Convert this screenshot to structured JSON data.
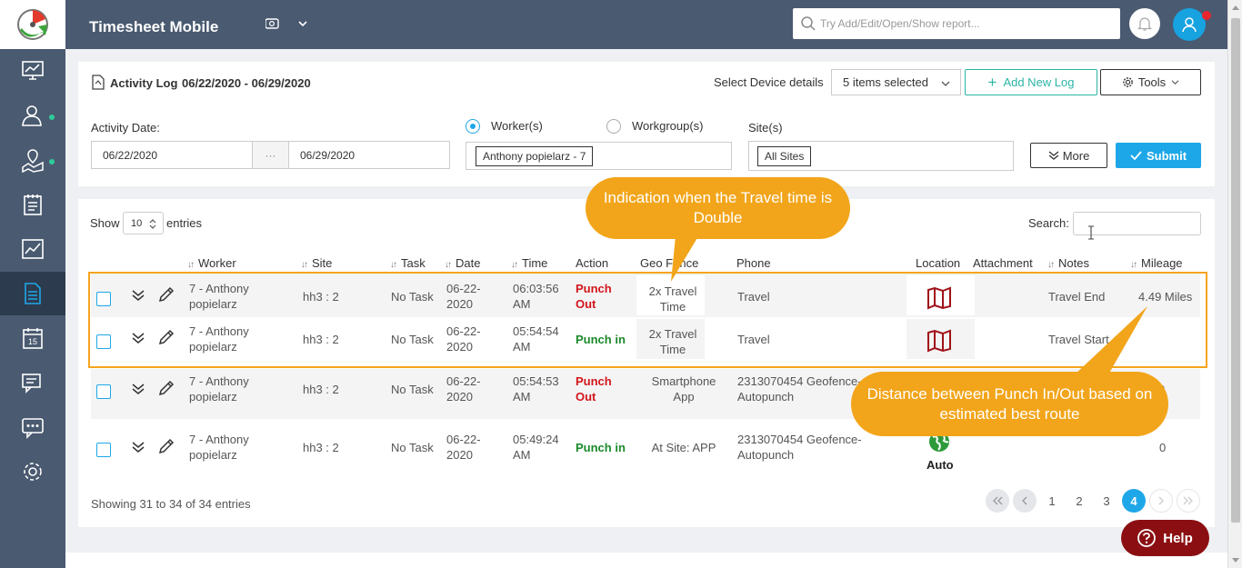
{
  "header": {
    "app_title": "Timesheet Mobile",
    "search_placeholder": "Try Add/Edit/Open/Show report..."
  },
  "sidebar": {
    "items": [
      "dashboard-icon",
      "workers-icon",
      "geo-location-icon",
      "timesheet-icon",
      "reports-chart-icon",
      "activity-log-icon",
      "calendar-icon",
      "messages-icon",
      "chat-icon",
      "settings-icon"
    ],
    "calendar_day": "15",
    "active": "activity-log-icon"
  },
  "filters": {
    "title": "Activity Log",
    "range": "06/22/2020 - 06/29/2020",
    "select_device_label": "Select Device details",
    "device_selected": "5 items selected",
    "add_log": "Add New Log",
    "tools": "Tools",
    "activity_date_label": "Activity Date:",
    "date_from": "06/22/2020",
    "date_sep": "···",
    "date_to": "06/29/2020",
    "worker_option": "Worker(s)",
    "workgroup_option": "Workgroup(s)",
    "worker_tag": "Anthony popielarz - 7",
    "sites_label": "Site(s)",
    "site_tag": "All Sites",
    "more": "More",
    "submit": "Submit"
  },
  "table": {
    "show_label": "Show",
    "page_size": "10",
    "entries_label": "entries",
    "search_label": "Search:",
    "columns": [
      "Worker",
      "Site",
      "Task",
      "Date",
      "Time",
      "Action",
      "Geo Fence",
      "Phone",
      "Location",
      "Attachment",
      "Notes",
      "Mileage"
    ],
    "rows": [
      {
        "worker": "7 - Anthony popielarz",
        "site": "hh3 : 2",
        "task": "No Task",
        "date": "06-22-2020",
        "time": "06:03:56 AM",
        "action": "Punch Out",
        "geo": "2x Travel Time",
        "phone": "Travel",
        "location": "map",
        "notes": "Travel End",
        "mileage": "4.49 Miles"
      },
      {
        "worker": "7 - Anthony popielarz",
        "site": "hh3 : 2",
        "task": "No Task",
        "date": "06-22-2020",
        "time": "05:54:54 AM",
        "action": "Punch in",
        "geo": "2x Travel Time",
        "phone": "Travel",
        "location": "map",
        "notes": "Travel Start",
        "mileage": ""
      },
      {
        "worker": "7 - Anthony popielarz",
        "site": "hh3 : 2",
        "task": "No Task",
        "date": "06-22-2020",
        "time": "05:54:53 AM",
        "action": "Punch Out",
        "geo": "Smartphone App",
        "phone": "2313070454 Geofence-Autopunch",
        "location": "",
        "notes": "",
        "mileage": "0"
      },
      {
        "worker": "7 - Anthony popielarz",
        "site": "hh3 : 2",
        "task": "No Task",
        "date": "06-22-2020",
        "time": "05:49:24 AM",
        "action": "Punch in",
        "geo": "At Site: APP",
        "phone": "2313070454 Geofence-Autopunch",
        "location": "Auto",
        "notes": "",
        "mileage": "0"
      }
    ],
    "showing": "Showing 31 to 34 of 34 entries",
    "pages": [
      "1",
      "2",
      "3",
      "4"
    ],
    "active_page": "4"
  },
  "callouts": {
    "travel_double": "Indication when the Travel time is Double",
    "distance": "Distance between Punch In/Out based on estimated best route"
  },
  "help": "Help",
  "colors": {
    "sidebar": "#4a5a70",
    "accent": "#1ea7e8",
    "callout": "#f2a51a",
    "punch_out": "#d3151a",
    "punch_in": "#1a8a2a"
  }
}
